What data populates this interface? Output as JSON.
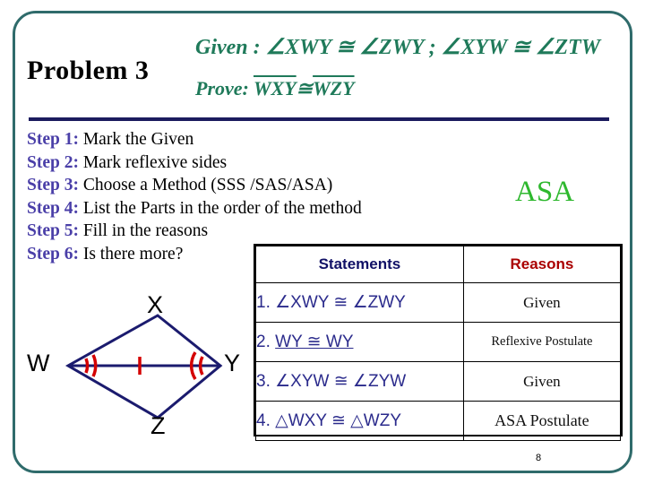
{
  "slide": {
    "title": "Problem 3",
    "given_label": "Given :",
    "given_text": "∠XWY ≅ ∠ZWY ; ∠XYW ≅ ∠ZTW",
    "prove_label": "Prove:",
    "prove_text_1": "WXY",
    "prove_text_2": "WZY",
    "prove_cong": "≅",
    "page_number": "8",
    "method_highlight": "ASA"
  },
  "steps": [
    {
      "label": "Step 1:",
      "text": "Mark the Given"
    },
    {
      "label": "Step 2:",
      "text": "Mark reflexive sides"
    },
    {
      "label": "Step 3:",
      "text": "Choose a Method (SSS /SAS/ASA)"
    },
    {
      "label": "Step 4:",
      "text": "List the Parts in the order of the method"
    },
    {
      "label": "Step 5:",
      "text": "Fill in the reasons"
    },
    {
      "label": "Step 6:",
      "text": "Is there more?"
    }
  ],
  "diagram": {
    "vertices": [
      {
        "name": "X",
        "label": "X"
      },
      {
        "name": "W",
        "label": "W"
      },
      {
        "name": "Y",
        "label": "Y"
      },
      {
        "name": "Z",
        "label": "Z"
      }
    ]
  },
  "table": {
    "headers": {
      "statements": "Statements",
      "reasons": "Reasons"
    },
    "rows": [
      {
        "num": "1.",
        "statement": "∠XWY ≅ ∠ZWY",
        "reason": "Given"
      },
      {
        "num": "2.",
        "statement": "WY ≅ WY",
        "reason": "Reflexive Postulate"
      },
      {
        "num": "3.",
        "statement": "∠XYW ≅ ∠ZYW",
        "reason": "Given"
      },
      {
        "num": "4.",
        "statement": "△WXY ≅ △WZY",
        "reason": "ASA Postulate"
      }
    ]
  }
}
